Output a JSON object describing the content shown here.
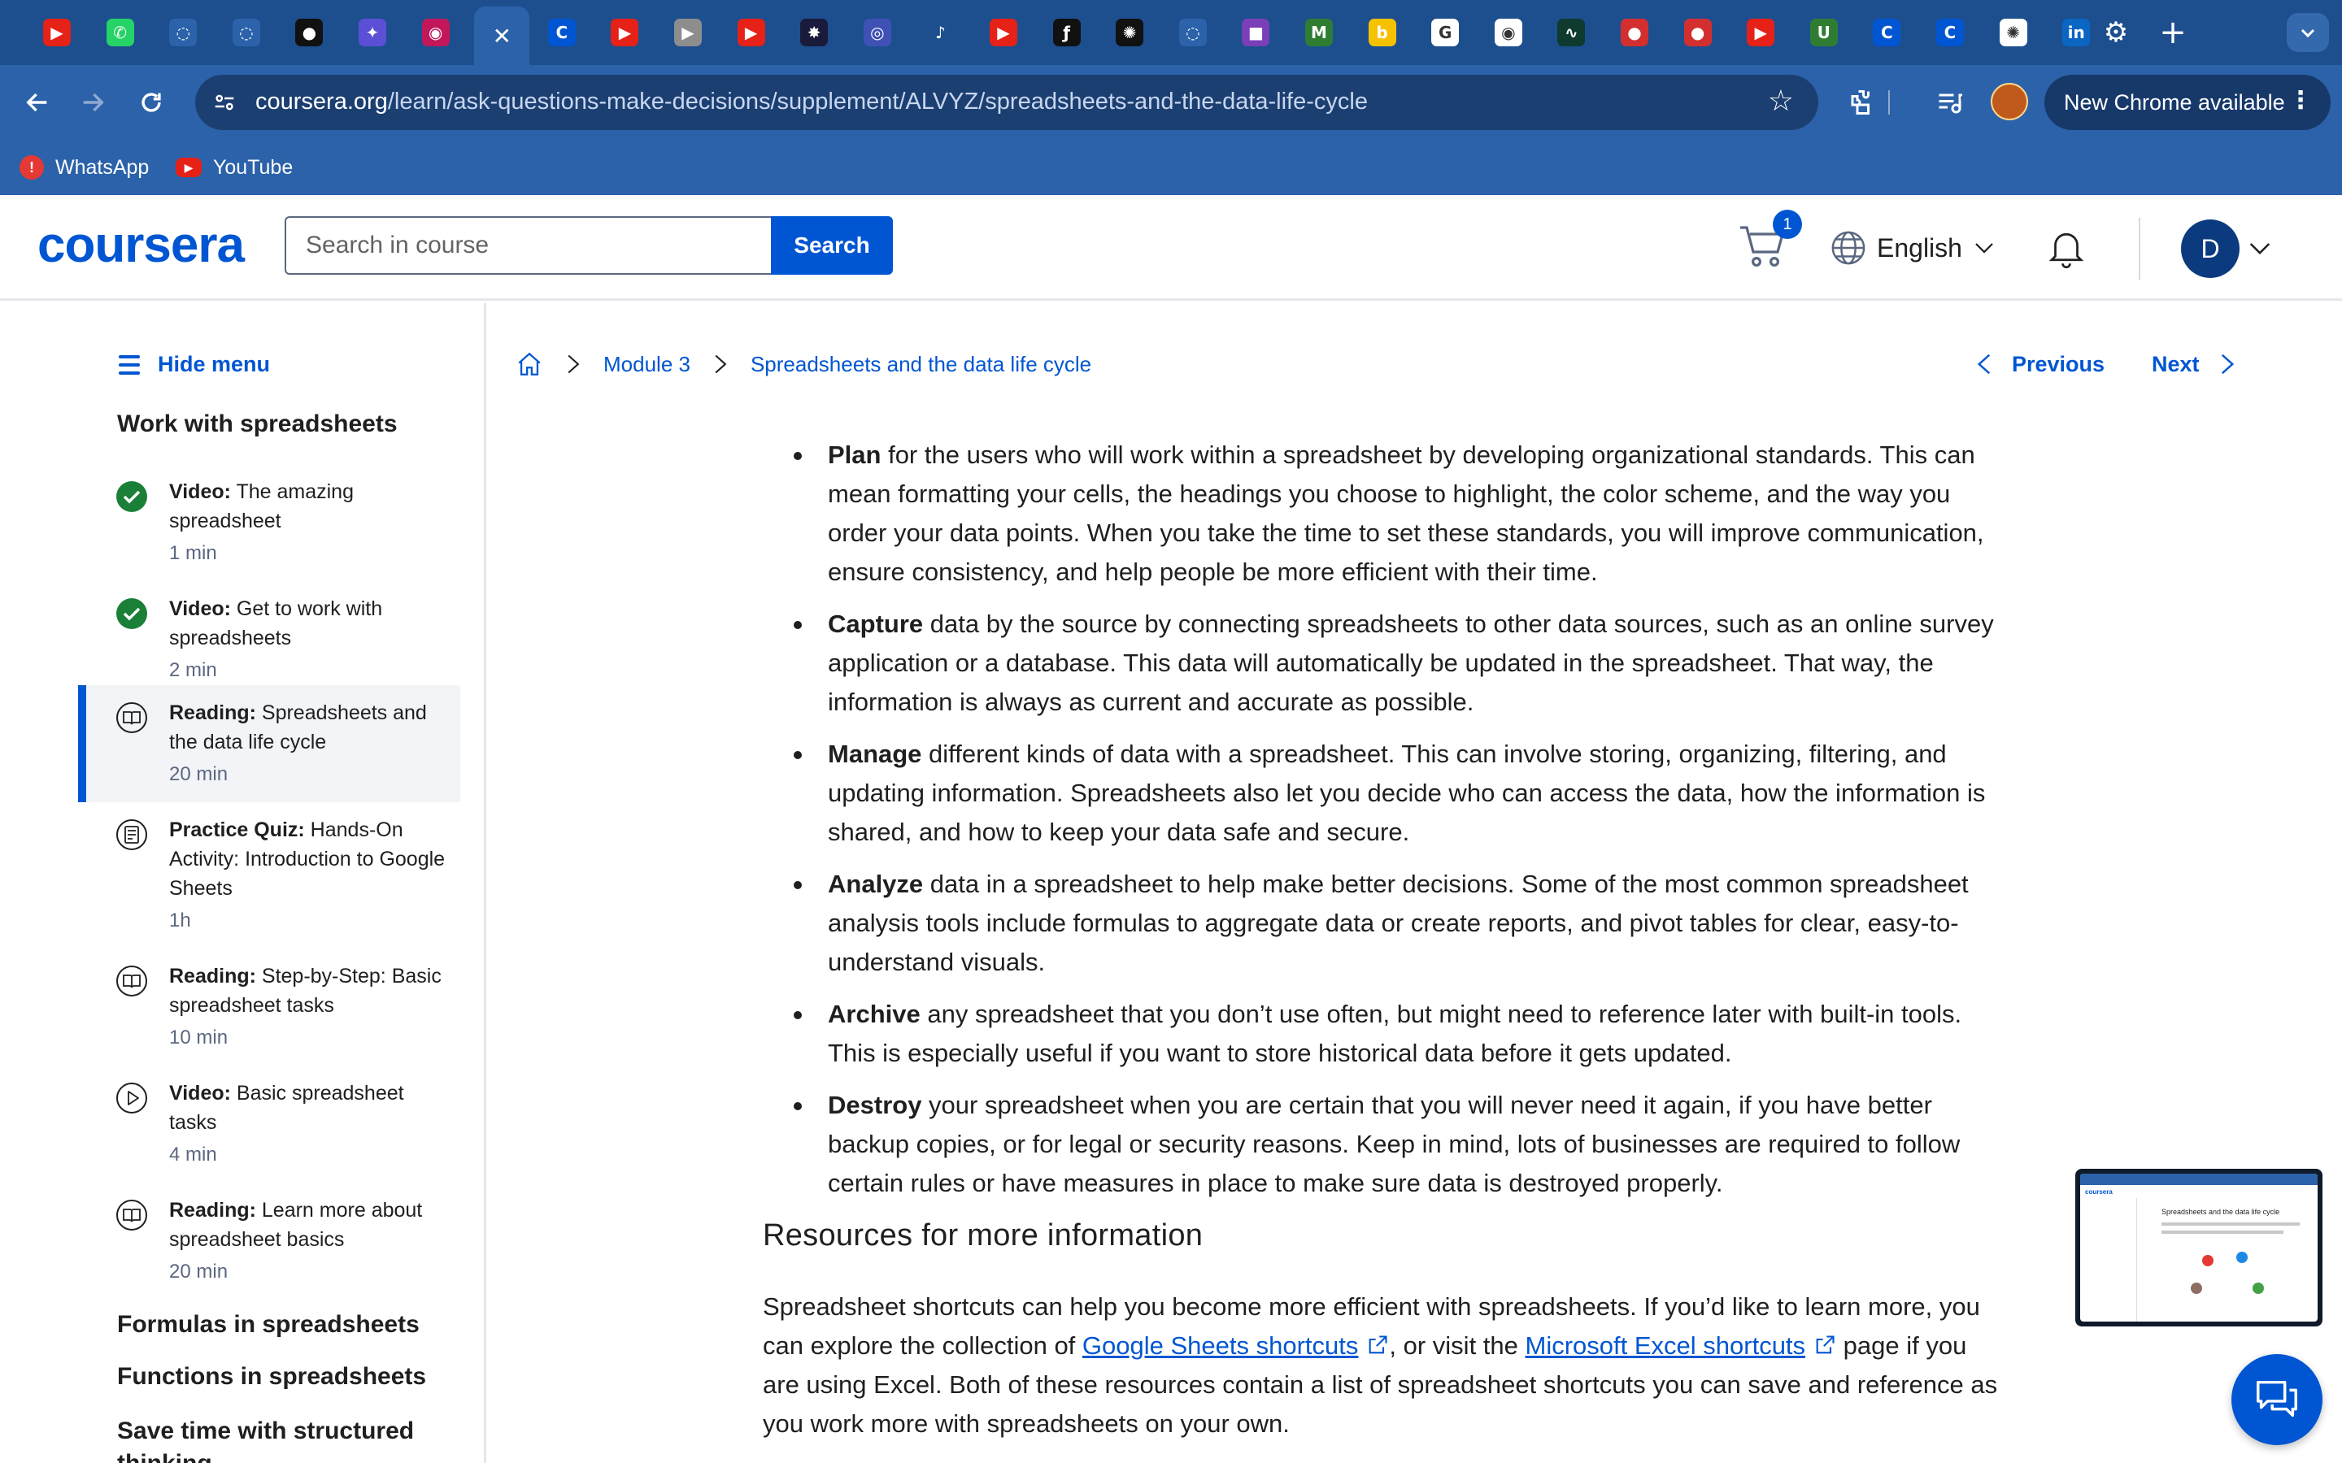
{
  "browser": {
    "tabs": [
      {
        "icon": "youtube-icon",
        "glyph": "▶",
        "color": "#e62117"
      },
      {
        "icon": "whatsapp-icon",
        "glyph": "✆",
        "color": "#25d366"
      },
      {
        "icon": "loading-icon",
        "glyph": "◌",
        "color": "#2b62a9"
      },
      {
        "icon": "loading-icon",
        "glyph": "◌",
        "color": "#2b62a9"
      },
      {
        "icon": "github-icon",
        "glyph": "●",
        "color": "#111111"
      },
      {
        "icon": "gemini-icon",
        "glyph": "✦",
        "color": "#5b4fd6"
      },
      {
        "icon": "app-icon",
        "glyph": "◉",
        "color": "#c2185b"
      },
      {
        "icon": "close-icon",
        "glyph": "✕",
        "color": "#2b62a9"
      },
      {
        "icon": "coursera-icon",
        "glyph": "C",
        "color": "#0056d2"
      },
      {
        "icon": "youtube-icon",
        "glyph": "▶",
        "color": "#e62117"
      },
      {
        "icon": "video-icon",
        "glyph": "▶",
        "color": "#8d8d8d"
      },
      {
        "icon": "youtube-icon",
        "glyph": "▶",
        "color": "#e62117"
      },
      {
        "icon": "app-icon",
        "glyph": "✸",
        "color": "#1a1a3a"
      },
      {
        "icon": "app-icon",
        "glyph": "◎",
        "color": "#3f51b5"
      },
      {
        "icon": "speaker-icon",
        "glyph": "♪",
        "color": "#1d4f8f"
      },
      {
        "icon": "youtube-icon",
        "glyph": "▶",
        "color": "#e62117"
      },
      {
        "icon": "app-icon",
        "glyph": "ƒ",
        "color": "#111111"
      },
      {
        "icon": "openai-icon",
        "glyph": "✺",
        "color": "#111111"
      },
      {
        "icon": "loading-icon",
        "glyph": "◌",
        "color": "#2b62a9"
      },
      {
        "icon": "camera-icon",
        "glyph": "■",
        "color": "#7b3fb8"
      },
      {
        "icon": "app-icon",
        "glyph": "M",
        "color": "#2e7d32"
      },
      {
        "icon": "app-icon",
        "glyph": "b",
        "color": "#f6c200"
      },
      {
        "icon": "google-icon",
        "glyph": "G",
        "color": "#ffffff"
      },
      {
        "icon": "app-icon",
        "glyph": "◉",
        "color": "#ffffff"
      },
      {
        "icon": "chart-icon",
        "glyph": "∿",
        "color": "#0f3a2f"
      },
      {
        "icon": "app-icon",
        "glyph": "●",
        "color": "#d32f2f"
      },
      {
        "icon": "app-icon",
        "glyph": "●",
        "color": "#d32f2f"
      },
      {
        "icon": "youtube-icon",
        "glyph": "▶",
        "color": "#e62117"
      },
      {
        "icon": "app-icon",
        "glyph": "U",
        "color": "#2e7d32"
      },
      {
        "icon": "coursera-icon",
        "glyph": "C",
        "color": "#0056d2"
      },
      {
        "icon": "coursera-icon",
        "glyph": "C",
        "color": "#0056d2"
      },
      {
        "icon": "openai-icon",
        "glyph": "✺",
        "color": "#ffffff"
      },
      {
        "icon": "linkedin-icon",
        "glyph": "in",
        "color": "#0a66c2"
      },
      {
        "icon": "settings-icon",
        "glyph": "⚙",
        "color": "#1d4f8f"
      }
    ],
    "url_domain": "coursera.org",
    "url_path": "/learn/ask-questions-make-decisions/supplement/ALVYZ/spreadsheets-and-the-data-life-cycle",
    "new_chrome_label": "New Chrome available",
    "bookmarks": [
      {
        "label": "WhatsApp",
        "icon": "whatsapp-icon",
        "color": "#e53935"
      },
      {
        "label": "YouTube",
        "icon": "youtube-icon",
        "color": "#e62117"
      }
    ]
  },
  "header": {
    "logo": "coursera",
    "search_placeholder": "Search in course",
    "search_button": "Search",
    "cart_count": "1",
    "language": "English",
    "avatar_initial": "D"
  },
  "sidebar": {
    "hide_menu": "Hide menu",
    "section_current": "Work with spreadsheets",
    "items": [
      {
        "type": "Video:",
        "title": "The amazing spreadsheet",
        "duration": "1 min",
        "status": "completed"
      },
      {
        "type": "Video:",
        "title": "Get to work with spreadsheets",
        "duration": "2 min",
        "status": "completed"
      },
      {
        "type": "Reading:",
        "title": "Spreadsheets and the data life cycle",
        "duration": "20 min",
        "status": "active"
      },
      {
        "type": "Practice Quiz:",
        "title": "Hands-On Activity: Introduction to Google Sheets",
        "duration": "1h",
        "status": "quiz"
      },
      {
        "type": "Reading:",
        "title": "Step-by-Step: Basic spreadsheet tasks",
        "duration": "10 min",
        "status": "reading"
      },
      {
        "type": "Video:",
        "title": "Basic spreadsheet tasks",
        "duration": "4 min",
        "status": "video"
      },
      {
        "type": "Reading:",
        "title": "Learn more about spreadsheet basics",
        "duration": "20 min",
        "status": "reading"
      }
    ],
    "sections": [
      "Formulas in spreadsheets",
      "Functions in spreadsheets",
      "Save time with structured thinking"
    ]
  },
  "breadcrumb": {
    "module": "Module 3",
    "page": "Spreadsheets and the data life cycle",
    "previous": "Previous",
    "next": "Next"
  },
  "content": {
    "bullets": [
      {
        "term": "Plan",
        "text": " for the users who will work within a spreadsheet by developing organizational standards. This can mean formatting your cells, the headings you choose to highlight, the color scheme, and the way you order your data points. When you take the time to set these standards, you will improve communication, ensure consistency, and help people be more efficient with their time."
      },
      {
        "term": "Capture",
        "text": " data by the source by connecting spreadsheets to other data sources, such as an online survey application or a database. This data will automatically be updated in the spreadsheet. That way, the information is always as current and accurate as possible."
      },
      {
        "term": "Manage",
        "text": " different kinds of data with a spreadsheet. This can involve storing, organizing, filtering, and updating information. Spreadsheets also let you decide who can access the data, how the information is shared, and how to keep your data safe and secure."
      },
      {
        "term": "Analyze",
        "text": " data in a spreadsheet to help make better decisions. Some of the most common spreadsheet analysis tools include formulas to aggregate data or create reports, and pivot tables for clear, easy-to-understand visuals."
      },
      {
        "term": "Archive",
        "text": " any spreadsheet that you don’t use often, but might need to reference later with built-in tools. This is especially useful if you want to store historical data before it gets updated."
      },
      {
        "term": "Destroy",
        "text": " your spreadsheet when you are certain that you will never need it again, if you have better backup copies, or for legal or security reasons. Keep in mind, lots of businesses are required to follow certain rules or have measures in place to make sure data is destroyed properly."
      }
    ],
    "resources_title": "Resources for more information",
    "resources_p1": "Spreadsheet shortcuts can help you become more efficient with spreadsheets. If you’d like to learn more, you can explore the collection of ",
    "link_google": "Google Sheets shortcuts",
    "resources_p2": ", or visit the ",
    "link_excel": "Microsoft Excel shortcuts",
    "resources_p3": " page if you are using Excel. Both of these resources contain a list of spreadsheet shortcuts you can save and reference as you work more with spreadsheets on your own."
  },
  "thumbnail": {
    "logo": "coursera",
    "title": "Spreadsheets and the data life cycle"
  },
  "colors": {
    "brand": "#0056d2",
    "chrome_frame": "#1d4f8f",
    "chrome_toolbar": "#2b62a9",
    "completed": "#1a7f37"
  }
}
